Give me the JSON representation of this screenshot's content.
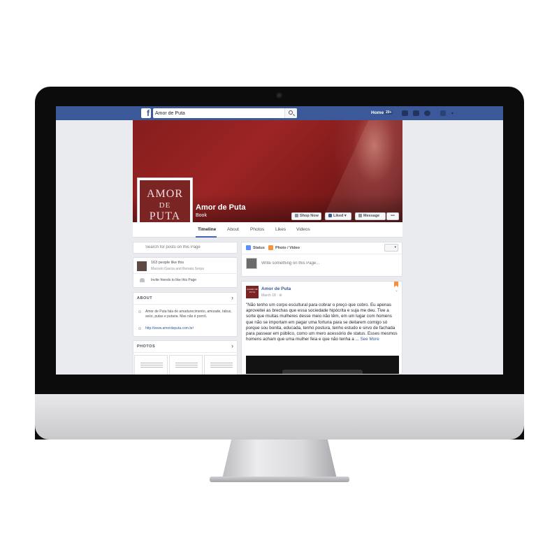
{
  "topbar": {
    "logo": "f",
    "search_value": "Amor de Puta",
    "home_label": "Home",
    "home_count": "20+"
  },
  "page": {
    "name": "Amor de Puta",
    "category": "Book",
    "profile_logo_lines": [
      "AMOR",
      "DE",
      "PUTA"
    ],
    "buttons": {
      "shop_now": "Shop Now",
      "liked": "Liked ▾",
      "message": "Message",
      "more": "•••"
    },
    "tabs": [
      "Timeline",
      "About",
      "Photos",
      "Likes",
      "Videos"
    ]
  },
  "sidebar": {
    "search_placeholder": "Search for posts on this Page",
    "likes": {
      "count_text": "163 people like this",
      "friends_text": "Marcelo Garcia and Renata Serpa",
      "invite_text": "Invite friends to like this Page"
    },
    "about": {
      "heading": "ABOUT",
      "description": "Amor de Puta fala de amadurecimento, amizade, tabus, sexo, putas e putaria. Mas não é pornô.",
      "url": "http://www.amordeputa.com.br/"
    },
    "photos": {
      "heading": "PHOTOS"
    }
  },
  "composer": {
    "status_label": "Status",
    "photo_label": "Photo / Video",
    "placeholder": "Write something on this Page..."
  },
  "post": {
    "author": "Amor de Puta",
    "date": "March 18 · ⚙",
    "avatar_text": "AMOR DE PUTA",
    "text": "\"Não tenho um corpo escultural para cobrar o preço que cobro. Eu apenas aproveitei as brechas que essa sociedade hipócrita e suja me deu. Tive a sorte que muitas mulheres desse meio não têm, em um lugar com homens que não se importam em pagar uma fortuna para se deitarem comigo só porque sou bonita, educada, tenho postura, tenho estudo e sirvo de fachada para passear em público, como um mero acessório de status. Esses mesmos homens acham que uma mulher feia e que não tenha a ...",
    "see_more": "See More"
  },
  "colors": {
    "facebook_blue": "#3b5998",
    "cover_red": "#861d1d",
    "link_blue": "#365899",
    "page_bg": "#e9ebee"
  }
}
